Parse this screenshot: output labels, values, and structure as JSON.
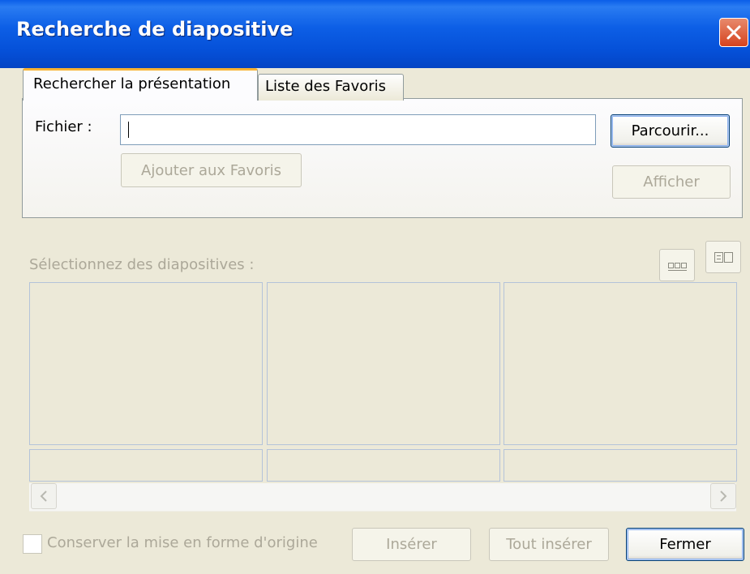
{
  "window": {
    "title": "Recherche de diapositive"
  },
  "tabs": [
    {
      "label": "Rechercher la présentation",
      "active": true
    },
    {
      "label": "Liste des Favoris",
      "active": false
    }
  ],
  "file": {
    "label": "Fichier :",
    "value": ""
  },
  "buttons": {
    "browse": "Parcourir...",
    "add_favorites": "Ajouter aux Favoris",
    "show": "Afficher",
    "insert": "Insérer",
    "insert_all": "Tout insérer",
    "close": "Fermer"
  },
  "slides": {
    "label": "Sélectionnez des diapositives :",
    "count": 3
  },
  "keep_format": {
    "label": "Conserver la mise en forme d'origine",
    "checked": false
  },
  "colors": {
    "titlebar": "#0554dc",
    "accent_tab": "#f8b332",
    "disabled_text": "#aca899"
  },
  "icons": [
    "close-icon",
    "thumbnail-view-icon",
    "title-view-icon",
    "scroll-left-arrow-icon",
    "scroll-right-arrow-icon"
  ]
}
